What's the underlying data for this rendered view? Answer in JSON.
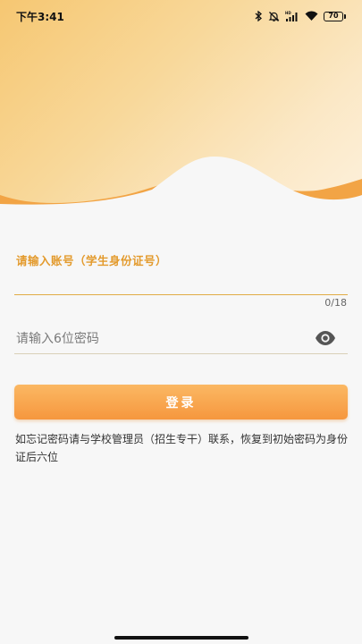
{
  "status_bar": {
    "time": "下午3:41",
    "battery": "70",
    "icons": [
      "bluetooth-icon",
      "bell-off-icon",
      "hd-signal-icon",
      "wifi-icon",
      "battery-icon"
    ]
  },
  "login": {
    "account_label": "请输入账号（学生身份证号）",
    "account_value": "",
    "account_counter": "0/18",
    "password_placeholder": "请输入6位密码",
    "password_value": "",
    "login_button": "登录",
    "notice": "如忘记密码请与学校管理员（招生专干）联系，恢复到初始密码为身份证后六位"
  },
  "colors": {
    "accent": "#f6973e",
    "label": "#e39a2c",
    "underline": "#e1ac45"
  }
}
